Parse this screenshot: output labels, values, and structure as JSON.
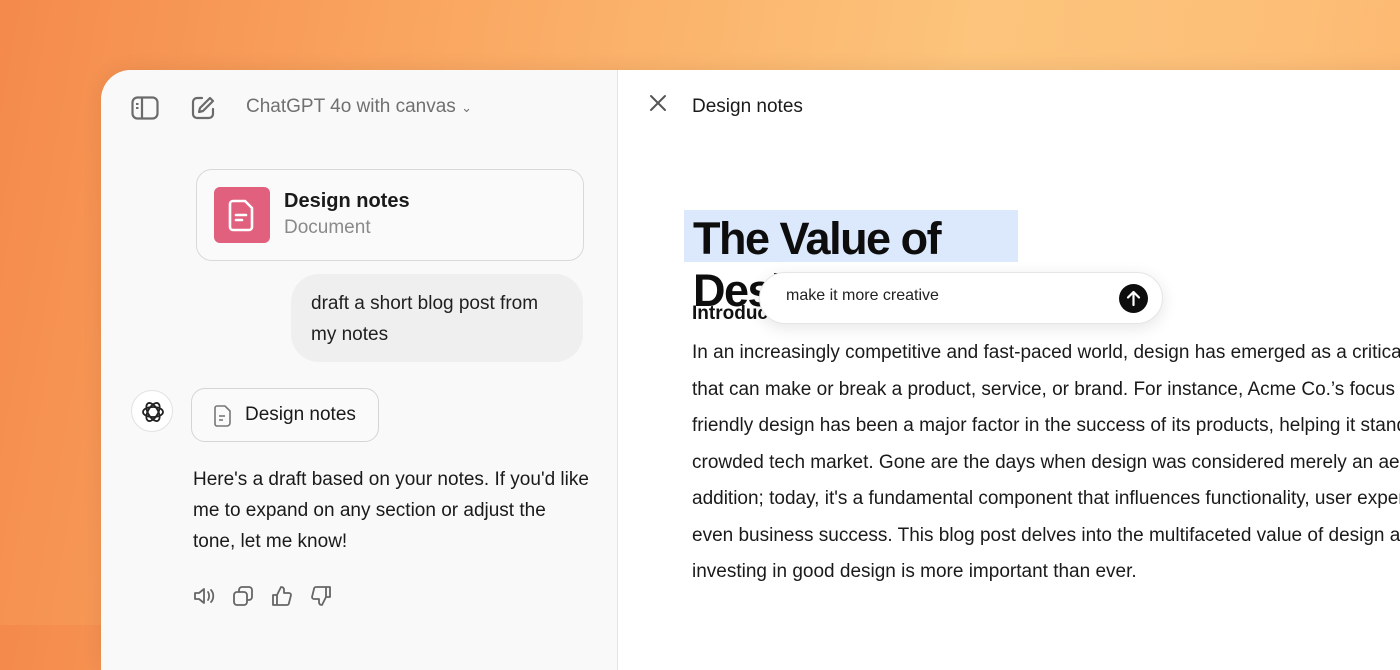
{
  "header": {
    "model_label": "ChatGPT 4o with canvas"
  },
  "chat": {
    "doc_card": {
      "title": "Design notes",
      "subtitle": "Document"
    },
    "user_message": "draft a short blog post from my notes",
    "doc_chip": "Design notes",
    "assistant_reply": "Here's a draft based on your notes. If you'd like me to expand on any section or adjust the tone, let me know!"
  },
  "canvas": {
    "title": "Design notes",
    "heading": "The Value of Design",
    "section": "Introduction",
    "lines": [
      "In an increasingly competitive and fast-paced world, design has emerged as a critical",
      "that can make or break a product, service, or brand. For instance, Acme Co.’s focus on",
      "friendly design has been a major factor in the success of its products, helping it stand",
      "crowded tech market. Gone are the days when design was considered merely an aesthetic",
      "addition; today, it's a fundamental component that influences functionality, user experience",
      "even business success. This blog post delves into the multifaceted value of design and",
      "investing in good design is more important than ever."
    ],
    "prompt_value": "make it more creative"
  },
  "colors": {
    "doc_icon": "#e0607e",
    "highlight": "#dce8fb"
  }
}
